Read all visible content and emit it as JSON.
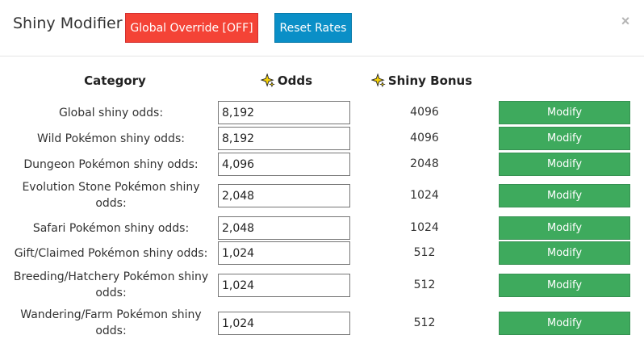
{
  "header": {
    "title": "Shiny Modifier",
    "override_label": "Global Override [OFF]",
    "reset_label": "Reset Rates",
    "close_glyph": "×",
    "colors": {
      "override": "#f44336",
      "reset": "#0a8fc7",
      "modify": "#3eaa5d"
    }
  },
  "columns": {
    "category": "Category",
    "odds": "Odds",
    "bonus": "Shiny Bonus",
    "icon": "sparkle-icon"
  },
  "rows": [
    {
      "label": "Global shiny odds:",
      "odds": "8,192",
      "bonus": "4096",
      "action": "Modify"
    },
    {
      "label": "Wild Pokémon shiny odds:",
      "odds": "8,192",
      "bonus": "4096",
      "action": "Modify"
    },
    {
      "label": "Dungeon Pokémon shiny odds:",
      "odds": "4,096",
      "bonus": "2048",
      "action": "Modify"
    },
    {
      "label": "Evolution Stone Pokémon shiny odds:",
      "odds": "2,048",
      "bonus": "1024",
      "action": "Modify"
    },
    {
      "label": "Safari Pokémon shiny odds:",
      "odds": "2,048",
      "bonus": "1024",
      "action": "Modify"
    },
    {
      "label": "Gift/Claimed Pokémon shiny odds:",
      "odds": "1,024",
      "bonus": "512",
      "action": "Modify"
    },
    {
      "label": "Breeding/Hatchery Pokémon shiny odds:",
      "odds": "1,024",
      "bonus": "512",
      "action": "Modify"
    },
    {
      "label": "Wandering/Farm Pokémon shiny odds:",
      "odds": "1,024",
      "bonus": "512",
      "action": "Modify"
    }
  ]
}
